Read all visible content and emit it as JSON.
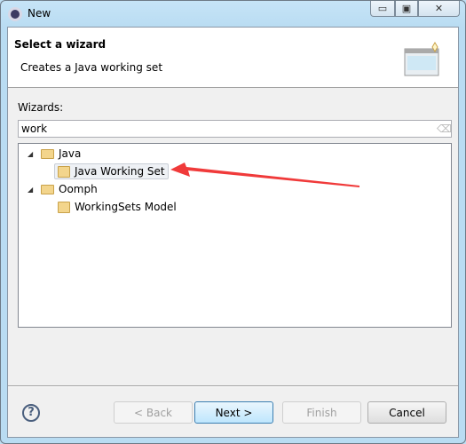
{
  "window": {
    "title": "New",
    "controls": [
      "minimize",
      "maximize",
      "close"
    ]
  },
  "header": {
    "title": "Select a wizard",
    "description": "Creates a Java working set"
  },
  "wizards": {
    "label": "Wizards:",
    "filter_value": "work",
    "filter_placeholder": "",
    "tree": [
      {
        "label": "Java",
        "expanded": true,
        "children": [
          {
            "label": "Java Working Set",
            "selected": true
          }
        ]
      },
      {
        "label": "Oomph",
        "expanded": true,
        "children": [
          {
            "label": "WorkingSets Model"
          }
        ]
      }
    ]
  },
  "buttons": {
    "back": "< Back",
    "next": "Next >",
    "finish": "Finish",
    "cancel": "Cancel"
  },
  "annotation": {
    "arrow_color": "#f03a3a"
  }
}
